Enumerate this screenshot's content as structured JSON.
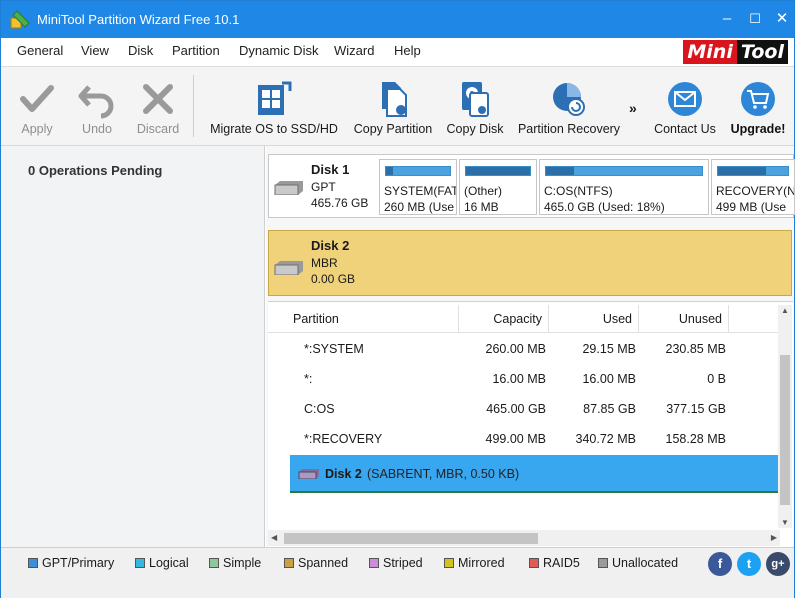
{
  "window": {
    "title": "MiniTool Partition Wizard Free 10.1",
    "minimize": "–",
    "maximize": "☐",
    "close": "✕"
  },
  "menu": [
    "General",
    "View",
    "Disk",
    "Partition",
    "Dynamic Disk",
    "Wizard",
    "Help"
  ],
  "logo": {
    "part1": "Mini",
    "part2": "Tool"
  },
  "toolbar": {
    "apply": "Apply",
    "undo": "Undo",
    "discard": "Discard",
    "migrate": "Migrate OS to SSD/HD",
    "copy_partition": "Copy Partition",
    "copy_disk": "Copy Disk",
    "partition_recovery": "Partition Recovery",
    "more": "»",
    "contact": "Contact Us",
    "upgrade": "Upgrade!"
  },
  "left": {
    "operations": "0 Operations Pending"
  },
  "disks": [
    {
      "name": "Disk 1",
      "type": "GPT",
      "size": "465.76 GB",
      "partitions": [
        {
          "name": "SYSTEM(FAT",
          "size": "260 MB (Use",
          "used_fraction": 0.11
        },
        {
          "name": "(Other)",
          "size": "16 MB",
          "used_fraction": 1.0
        },
        {
          "name": "C:OS(NTFS)",
          "size": "465.0 GB (Used: 18%)",
          "used_fraction": 0.18
        },
        {
          "name": "RECOVERY(N",
          "size": "499 MB (Use",
          "used_fraction": 0.68
        }
      ]
    },
    {
      "name": "Disk 2",
      "type": "MBR",
      "size": "0.00 GB"
    }
  ],
  "table": {
    "headers": {
      "partition": "Partition",
      "capacity": "Capacity",
      "used": "Used",
      "unused": "Unused"
    },
    "rows": [
      {
        "partition": "*:SYSTEM",
        "capacity": "260.00 MB",
        "used": "29.15 MB",
        "unused": "230.85 MB"
      },
      {
        "partition": "*:",
        "capacity": "16.00 MB",
        "used": "16.00 MB",
        "unused": "0 B"
      },
      {
        "partition": "C:OS",
        "capacity": "465.00 GB",
        "used": "87.85 GB",
        "unused": "377.15 GB"
      },
      {
        "partition": "*:RECOVERY",
        "capacity": "499.00 MB",
        "used": "340.72 MB",
        "unused": "158.28 MB"
      }
    ],
    "selected_disk": {
      "name": "Disk 2",
      "desc": "(SABRENT, MBR, 0.50 KB)"
    }
  },
  "legend": [
    {
      "label": "GPT/Primary",
      "color": "#3a8fd6"
    },
    {
      "label": "Logical",
      "color": "#34b8e0"
    },
    {
      "label": "Simple",
      "color": "#8fc79a"
    },
    {
      "label": "Spanned",
      "color": "#c9a046"
    },
    {
      "label": "Striped",
      "color": "#c98fd6"
    },
    {
      "label": "Mirrored",
      "color": "#d4c21c"
    },
    {
      "label": "RAID5",
      "color": "#e05a5a"
    },
    {
      "label": "Unallocated",
      "color": "#9a9a9a"
    }
  ],
  "social": {
    "facebook": "f",
    "twitter": "t",
    "google": "g+"
  },
  "colors": {
    "titlebar": "#1f88e6",
    "selection": "#38a7ef",
    "disk2_highlight": "#f0d27a"
  }
}
